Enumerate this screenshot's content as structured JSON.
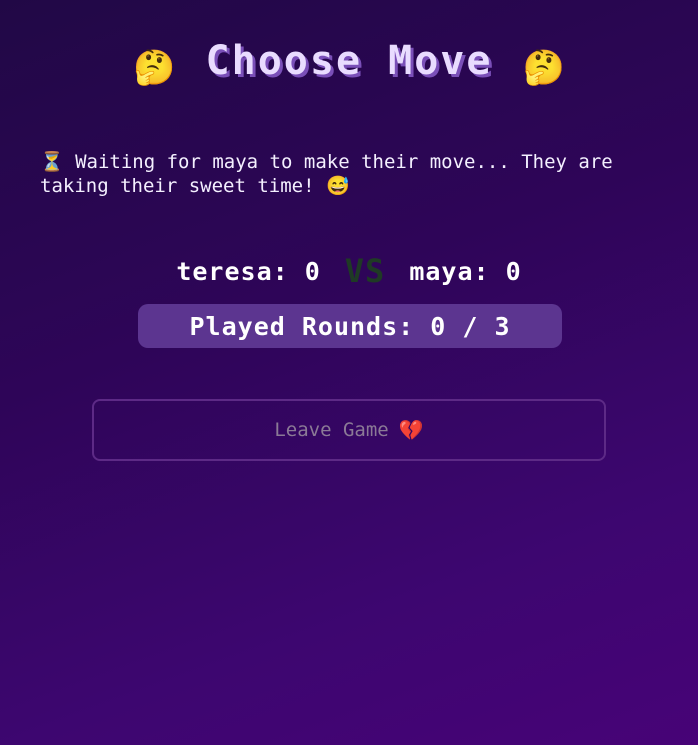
{
  "header": {
    "title": "Choose Move",
    "left_emoji": "🤔",
    "right_emoji": "🤔"
  },
  "status": {
    "waiting_message": "⏳ Waiting for maya to make their move... They are taking their sweet time! 😅"
  },
  "score": {
    "player1_label": "teresa: 0",
    "vs_label": "VS",
    "player2_label": "maya: 0"
  },
  "rounds": {
    "label": "Played Rounds: 0 / 3"
  },
  "actions": {
    "leave_label": "Leave Game",
    "leave_emoji": "💔"
  },
  "colors": {
    "background_start": "#210846",
    "background_end": "#470377",
    "title": "#e9dcff",
    "rounds_badge": "#5c3590",
    "leave_border": "#5d2a86",
    "leave_text": "#8b7a96",
    "vs_text": "#1f3a25"
  }
}
